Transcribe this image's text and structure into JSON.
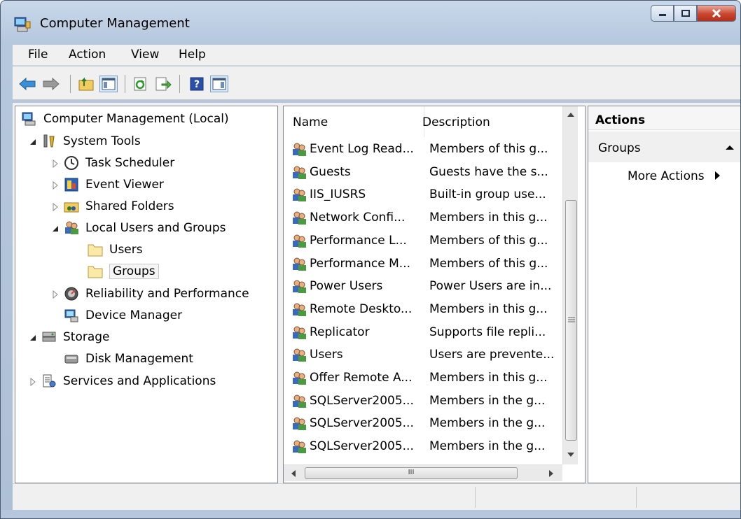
{
  "window": {
    "title": "Computer Management",
    "buttons": [
      "minimize",
      "maximize",
      "close"
    ]
  },
  "menu": [
    "File",
    "Action",
    "View",
    "Help"
  ],
  "toolbar": {
    "icons": [
      "back-arrow-icon",
      "forward-arrow-icon",
      "up-folder-icon",
      "show-hide-tree-icon",
      "refresh-icon",
      "export-list-icon",
      "help-icon",
      "show-hide-action-pane-icon"
    ]
  },
  "tree": {
    "items": [
      {
        "label": "Computer Management (Local)",
        "expander": "none",
        "icon": "computer-management-icon"
      },
      {
        "label": "System Tools",
        "expander": "expanded",
        "icon": "system-tools-icon"
      },
      {
        "label": "Task Scheduler",
        "expander": "collapsed",
        "icon": "clock-icon"
      },
      {
        "label": "Event Viewer",
        "expander": "collapsed",
        "icon": "event-viewer-icon"
      },
      {
        "label": "Shared Folders",
        "expander": "collapsed",
        "icon": "shared-folders-icon"
      },
      {
        "label": "Local Users and Groups",
        "expander": "expanded",
        "icon": "users-icon"
      },
      {
        "label": "Users",
        "expander": "none",
        "icon": "folder-icon"
      },
      {
        "label": "Groups",
        "expander": "none",
        "icon": "folder-icon",
        "selected": true
      },
      {
        "label": "Reliability and Performance",
        "expander": "collapsed",
        "icon": "performance-icon"
      },
      {
        "label": "Device Manager",
        "expander": "none",
        "icon": "device-manager-icon"
      },
      {
        "label": "Storage",
        "expander": "expanded",
        "icon": "storage-icon"
      },
      {
        "label": "Disk Management",
        "expander": "none",
        "icon": "disk-icon"
      },
      {
        "label": "Services and Applications",
        "expander": "collapsed",
        "icon": "services-icon"
      }
    ]
  },
  "list": {
    "columns": [
      "Name",
      "Description"
    ],
    "rows": [
      {
        "name": "Event Log Read...",
        "description": "Members of this g..."
      },
      {
        "name": "Guests",
        "description": "Guests have the s..."
      },
      {
        "name": "IIS_IUSRS",
        "description": "Built-in group use..."
      },
      {
        "name": "Network Confi...",
        "description": "Members in this g..."
      },
      {
        "name": "Performance L...",
        "description": "Members of this g..."
      },
      {
        "name": "Performance M...",
        "description": "Members of this g..."
      },
      {
        "name": "Power Users",
        "description": "Power Users are in..."
      },
      {
        "name": "Remote Deskto...",
        "description": "Members in this g..."
      },
      {
        "name": "Replicator",
        "description": "Supports file repli..."
      },
      {
        "name": "Users",
        "description": "Users are prevente..."
      },
      {
        "name": "Offer Remote A...",
        "description": "Members in this g..."
      },
      {
        "name": "SQLServer2005...",
        "description": "Members in the g..."
      },
      {
        "name": "SQLServer2005...",
        "description": "Members in the g..."
      },
      {
        "name": "SQLServer2005...",
        "description": "Members in the g..."
      }
    ],
    "hscroll_grip": "III"
  },
  "actions": {
    "title": "Actions",
    "group": "Groups",
    "more": "More Actions"
  },
  "colors": {
    "frame": "#b6c8de",
    "close_button": "#c8452e",
    "panel_border": "#828790",
    "client_bg": "#f0f0f0"
  }
}
